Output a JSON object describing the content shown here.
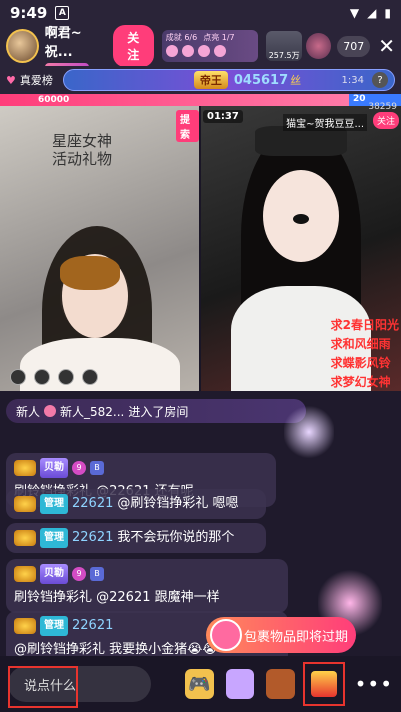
{
  "status_bar": {
    "time": "9:49",
    "app_icon": "A"
  },
  "header": {
    "host_name": "啊君~祝...",
    "follow_label": "关注",
    "achievement": {
      "text1": "成就 6/6",
      "text2": "点亮 1/7"
    },
    "viewer_thumb_text": "257.5万",
    "online_count": "707"
  },
  "rank": {
    "label": "真爱榜",
    "title": "帝王",
    "score": "045617",
    "score_suffix": "丝",
    "time_left": "1:34",
    "help": "?"
  },
  "pk": {
    "left_score": "60000",
    "left_fraction": 0.87
  },
  "video_left": {
    "tag": "提索",
    "overlay_line1": "星座女神",
    "overlay_line2": "活动礼物"
  },
  "video_right": {
    "timer": "01:37",
    "peer_name": "猫宝~贺我豆豆...",
    "peer_follow": "关注",
    "peer_count": "38259",
    "peer_rank": "20",
    "overlay_lines": [
      "求2春日阳光",
      "求和风细雨",
      "求蝶影风铃",
      "求梦幻女神"
    ]
  },
  "chat": {
    "enter": {
      "prefix": "新人",
      "name": "新人_582...",
      "text": "进入了房间"
    },
    "messages": [
      {
        "role": "贝勒",
        "user": "",
        "text": "刷铃铛挣彩礼 @22621 还有呢"
      },
      {
        "role": "管理",
        "user": "22621",
        "text": "@刷铃铛挣彩礼 嗯嗯"
      },
      {
        "role": "管理",
        "user": "22621",
        "text": "我不会玩你说的那个"
      },
      {
        "role": "贝勒",
        "user": "",
        "text": "刷铃铛挣彩礼 @22621 跟魔神一样"
      },
      {
        "role": "管理",
        "user": "22621",
        "text": "@刷铃铛挣彩礼 我要换小金猪😭😭"
      }
    ],
    "promo": "包裹物品即将过期"
  },
  "bottom": {
    "input_placeholder": "说点什么"
  }
}
